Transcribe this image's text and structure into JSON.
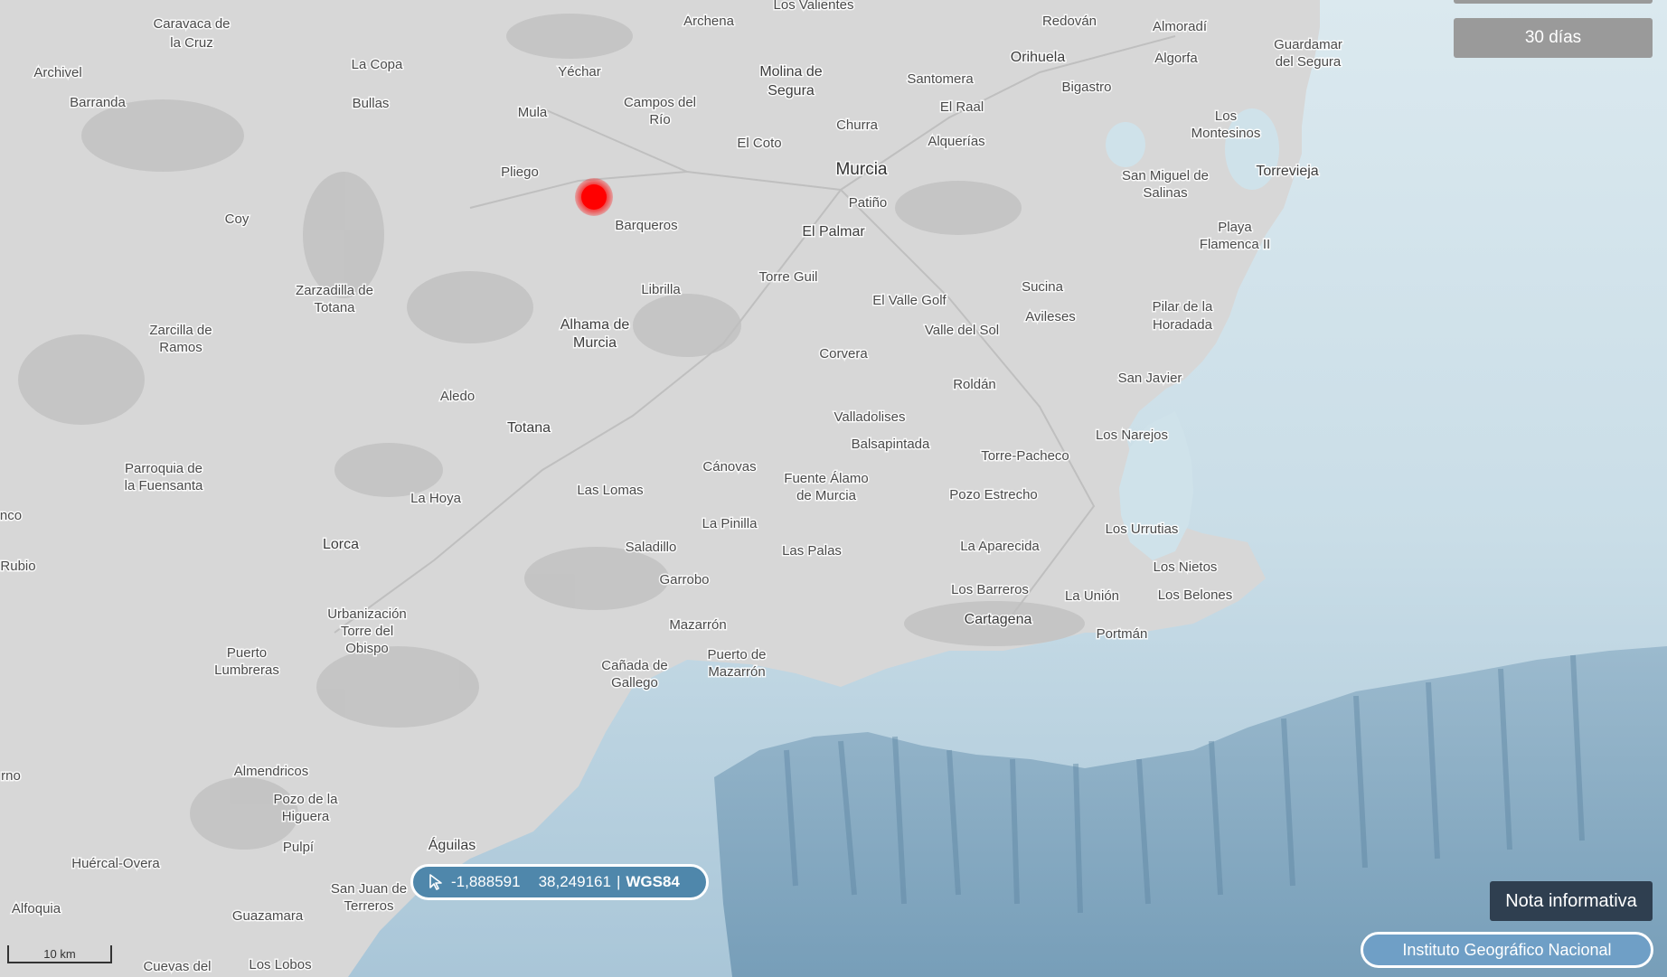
{
  "controls": {
    "period_button": "30 días",
    "nota_informativa": "Nota informativa",
    "ign_link": "Instituto Geográfico Nacional"
  },
  "coordinates": {
    "cursor_icon": "cursor-arrow-icon",
    "longitude": "-1,888591",
    "latitude": "38,249161",
    "separator": "|",
    "datum": "WGS84"
  },
  "scale_bar": {
    "label": "10 km"
  },
  "epicenter": {
    "color": "#ff0000",
    "marker": "earthquake-epicenter-dot"
  },
  "colors": {
    "land": "#d6d6d6",
    "sea": "#cfe2ea",
    "deep_sea": "#7fa3bd",
    "coords_bg": "#4f87ab",
    "nota_bg": "#2f3f50"
  },
  "places": {
    "caravaca": [
      "Caravaca de",
      "la Cruz"
    ],
    "archivel": "Archivel",
    "barranda": "Barranda",
    "la_copa": "La Copa",
    "bullas": "Bullas",
    "yechar": "Yéchar",
    "mula": "Mula",
    "archena": "Archena",
    "los_valientes": "Los Valientes",
    "campos_rio": [
      "Campos del",
      "Río"
    ],
    "molina": [
      "Molina de",
      "Segura"
    ],
    "santomera": "Santomera",
    "redovan": "Redován",
    "orihuela": "Orihuela",
    "almoradi": "Almoradí",
    "algorfa": "Algorfa",
    "guardamar": [
      "Guardamar",
      "del Segura"
    ],
    "bigastro": "Bigastro",
    "el_raal": "El Raal",
    "churra": "Churra",
    "el_coto": "El Coto",
    "alquerias": "Alquerías",
    "murcia": "Murcia",
    "los_montesinos": [
      "Los",
      "Montesinos"
    ],
    "san_miguel": [
      "San Miguel de",
      "Salinas"
    ],
    "torrevieja": "Torrevieja",
    "pliego": "Pliego",
    "coy": "Coy",
    "barqueros": "Barqueros",
    "patino": "Patiño",
    "el_palmar": "El Palmar",
    "playa_flamenca": [
      "Playa",
      "Flamenca II"
    ],
    "torre_guil": "Torre Guil",
    "librilla": "Librilla",
    "zarzadilla": [
      "Zarzadilla de",
      "Totana"
    ],
    "zarcilla": [
      "Zarcilla de",
      "Ramos"
    ],
    "alhama": [
      "Alhama de",
      "Murcia"
    ],
    "sucina": "Sucina",
    "el_valle_golf": "El Valle Golf",
    "avileses": "Avileses",
    "pilar_horadada": [
      "Pilar de la",
      "Horadada"
    ],
    "valle_del_sol": "Valle del Sol",
    "corvera": "Corvera",
    "san_javier": "San Javier",
    "roldan": "Roldán",
    "aledo": "Aledo",
    "totana": "Totana",
    "valladolises": "Valladolises",
    "los_narejos": "Los Narejos",
    "balsapintada": "Balsapintada",
    "torre_pacheco": "Torre-Pacheco",
    "parroquia": [
      "Parroquia de",
      "la Fuensanta"
    ],
    "canovas": "Cánovas",
    "fuente_alamo": [
      "Fuente Álamo",
      "de Murcia"
    ],
    "la_hoya": "La Hoya",
    "las_lomas": "Las Lomas",
    "pozo_estrecho": "Pozo Estrecho",
    "edge_nco": "nco",
    "la_pinilla": "La Pinilla",
    "los_urrutias": "Los Urrutias",
    "lorca": "Lorca",
    "saladillo": "Saladillo",
    "las_palas": "Las Palas",
    "la_aparecida": "La Aparecida",
    "rubio": "Rubio",
    "los_nietos": "Los Nietos",
    "garrobo": "Garrobo",
    "los_barreros": "Los Barreros",
    "la_union": "La Unión",
    "los_belones": "Los Belones",
    "urbanizacion": [
      "Urbanización",
      "Torre del",
      "Obispo"
    ],
    "cartagena": "Cartagena",
    "mazarron": "Mazarrón",
    "portman": "Portmán",
    "puerto_lumbreras": [
      "Puerto",
      "Lumbreras"
    ],
    "puerto_mazarron": [
      "Puerto de",
      "Mazarrón"
    ],
    "canada_gallego": [
      "Cañada de",
      "Gallego"
    ],
    "almendricos": "Almendricos",
    "edge_rno": "rno",
    "pozo_higuera": [
      "Pozo de la",
      "Higuera"
    ],
    "aguilas": "Águilas",
    "pulpi": "Pulpí",
    "huercal": "Huércal-Overa",
    "san_juan_terreros": [
      "San Juan de",
      "Terreros"
    ],
    "alfoquia": "Alfoquia",
    "guazamara": "Guazamara",
    "cuevas": "Cuevas del",
    "los_lobos": "Los Lobos"
  }
}
